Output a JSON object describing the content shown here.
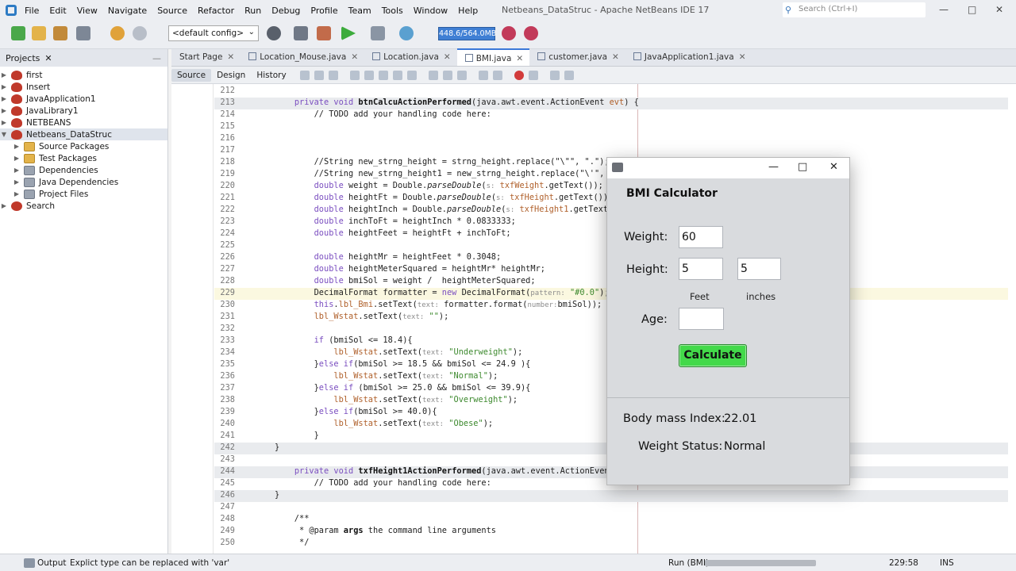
{
  "window": {
    "title": "Netbeans_DataStruc - Apache NetBeans IDE 17",
    "search_placeholder": "Search (Ctrl+I)"
  },
  "menu": [
    "File",
    "Edit",
    "View",
    "Navigate",
    "Source",
    "Refactor",
    "Run",
    "Debug",
    "Profile",
    "Team",
    "Tools",
    "Window",
    "Help"
  ],
  "toolbar": {
    "config": "<default config>",
    "memory": "448.6/564.0MB"
  },
  "projects": {
    "tab_label": "Projects",
    "items": [
      "first",
      "Insert",
      "JavaApplication1",
      "JavaLibrary1",
      "NETBEANS",
      "Netbeans_DataStruc",
      "Source Packages",
      "Test Packages",
      "Dependencies",
      "Java Dependencies",
      "Project Files",
      "Search"
    ]
  },
  "tabs": [
    "Start Page",
    "Location_Mouse.java",
    "Location.java",
    "BMI.java",
    "customer.java",
    "JavaApplication1.java"
  ],
  "editor_buttons": [
    "Source",
    "Design",
    "History"
  ],
  "code": {
    "l212": "212",
    "l213": "213",
    "l214": "214",
    "l215": "215",
    "l216": "216",
    "l217": "217",
    "l218": "218",
    "l219": "219",
    "l220": "220",
    "l221": "221",
    "l222": "222",
    "l223": "223",
    "l224": "224",
    "l225": "225",
    "l226": "226",
    "l227": "227",
    "l228": "228",
    "l229": "229",
    "l230": "230",
    "l231": "231",
    "l232": "232",
    "l233": "233",
    "l234": "234",
    "l235": "235",
    "l236": "236",
    "l237": "237",
    "l238": "238",
    "l239": "239",
    "l240": "240",
    "l241": "241",
    "l242": "242",
    "l243": "243",
    "l244": "244",
    "l245": "245",
    "l246": "246",
    "l247": "247",
    "l248": "248",
    "l249": "249",
    "l250": "250"
  },
  "statusbar": {
    "output": "Output",
    "hint": "Explict type can be replaced with 'var'",
    "run": "Run (BMI)",
    "position": "229:58",
    "mode": "INS"
  },
  "bmi": {
    "heading": "BMI Calculator",
    "weight_label": "Weight:",
    "weight_value": "60",
    "height_label": "Height:",
    "height_feet_value": "5",
    "height_inch_value": "5",
    "feet_label": "Feet",
    "inches_label": "inches",
    "age_label": "Age:",
    "age_value": "",
    "calc_label": "Calculate",
    "bmi_label": "Body mass Index:",
    "bmi_value": "22.01",
    "status_label": "Weight Status:",
    "status_value": "Normal"
  }
}
